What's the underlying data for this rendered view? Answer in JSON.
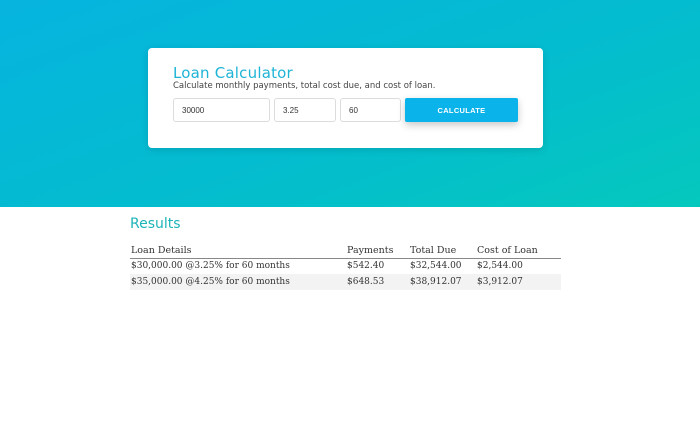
{
  "calculator": {
    "title": "Loan Calculator",
    "subtitle": "Calculate monthly payments, total cost due, and cost of loan.",
    "amount_value": "30000",
    "rate_value": "3.25",
    "months_value": "60",
    "button_label": "CALCULATE"
  },
  "results": {
    "title": "Results",
    "columns": [
      "Loan Details",
      "Payments",
      "Total Due",
      "Cost of Loan"
    ],
    "rows": [
      [
        "$30,000.00 @3.25% for 60 months",
        "$542.40",
        "$32,544.00",
        "$2,544.00"
      ],
      [
        "$35,000.00 @4.25% for 60 months",
        "$648.53",
        "$38,912.07",
        "$3,912.07"
      ]
    ]
  },
  "colors": {
    "hero_start": "#06b4df",
    "hero_end": "#05c8bd",
    "accent": "#0ab3ea",
    "title": "#1eb4d6"
  }
}
